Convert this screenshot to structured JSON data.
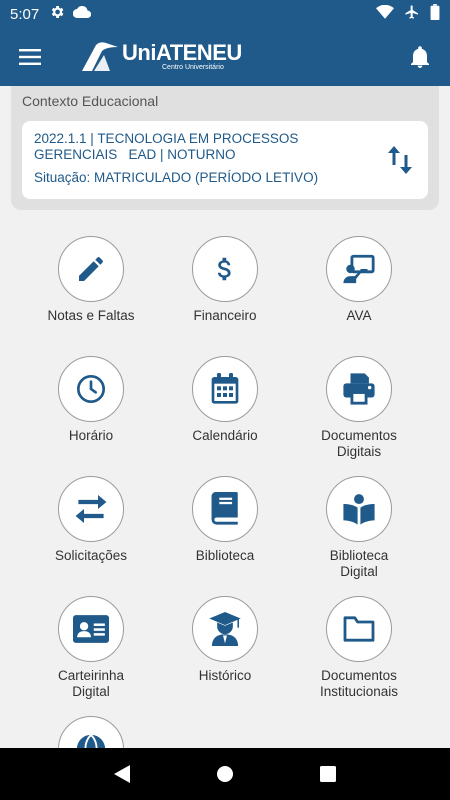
{
  "status_bar": {
    "time": "5:07"
  },
  "app": {
    "brand": "UniATENEU",
    "brand_sub": "Centro Universitário"
  },
  "context": {
    "title": "Contexto Educacional",
    "line1": "2022.1.1 | TECNOLOGIA EM PROCESSOS",
    "line2": "GERENCIAIS   EAD | NOTURNO",
    "status": "Situação: MATRICULADO (PERÍODO LETIVO)"
  },
  "menu": [
    {
      "label": "Notas e Faltas",
      "icon": "pencil-icon"
    },
    {
      "label": "Financeiro",
      "icon": "dollar-icon"
    },
    {
      "label": "AVA",
      "icon": "teacher-screen-icon"
    },
    {
      "label": "Horário",
      "icon": "clock-icon"
    },
    {
      "label": "Calendário",
      "icon": "calendar-icon"
    },
    {
      "label": "Documentos\nDigitais",
      "icon": "printer-icon"
    },
    {
      "label": "Solicitações",
      "icon": "exchange-arrows-icon"
    },
    {
      "label": "Biblioteca",
      "icon": "book-icon"
    },
    {
      "label": "Biblioteca\nDigital",
      "icon": "book-reader-icon"
    },
    {
      "label": "Carteirinha\nDigital",
      "icon": "id-card-icon"
    },
    {
      "label": "Histórico",
      "icon": "graduate-icon"
    },
    {
      "label": "Documentos\nInstitucionais",
      "icon": "folder-icon"
    },
    {
      "label": "",
      "icon": "globe-icon"
    }
  ],
  "colors": {
    "primary": "#1f5a8a",
    "background": "#f1f1f1",
    "card": "#e0e0e0"
  }
}
